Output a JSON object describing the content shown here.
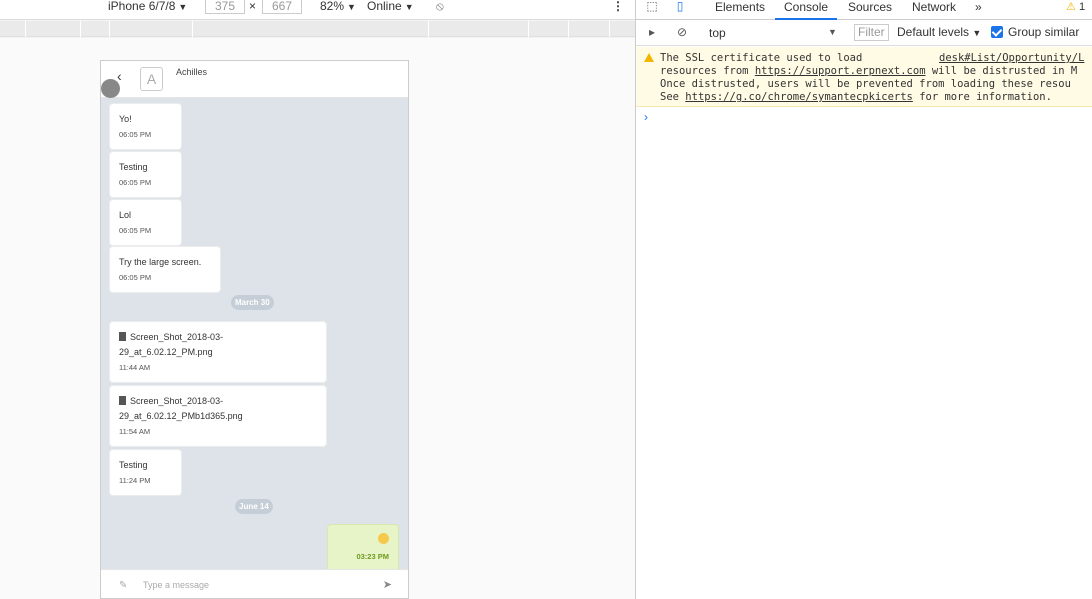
{
  "devtoolbar": {
    "device": "iPhone 6/7/8",
    "width": "375",
    "times": "×",
    "height": "667",
    "zoom": "82%",
    "network": "Online"
  },
  "chat": {
    "name": "Achilles",
    "avatar_letter": "A",
    "messages": [
      {
        "text": "Yo!",
        "time": "06:05 PM"
      },
      {
        "text": "Testing",
        "time": "06:05 PM"
      },
      {
        "text": "Lol",
        "time": "06:05 PM"
      },
      {
        "text": "Try the large screen.",
        "time": "06:05 PM"
      },
      {
        "file_line1": "Screen_Shot_2018-03-",
        "file_line2": "29_at_6.02.12_PM.png",
        "time": "11:44 AM"
      },
      {
        "file_line1": "Screen_Shot_2018-03-",
        "file_line2": "29_at_6.02.12_PMb1d365.png",
        "time": "11:54 AM"
      },
      {
        "text": "Testing",
        "time": "11:24 PM"
      },
      {
        "time": "03:23 PM"
      }
    ],
    "dates": [
      "March 30",
      "June 14"
    ],
    "composer_placeholder": "Type a message"
  },
  "devtools": {
    "tabs": [
      "Elements",
      "Console",
      "Sources",
      "Network"
    ],
    "more": "»",
    "warning_count": "1",
    "context": "top",
    "filter": "Filter",
    "levels": "Default levels",
    "group_similar": "Group similar",
    "warning": {
      "l1a": "The SSL certificate used to load",
      "l1b": "desk#List/Opportunity/L",
      "l2a": "resources from ",
      "l2link": "https://support.erpnext.com",
      "l2b": " will be distrusted in M",
      "l3": "Once distrusted, users will be prevented from loading these resou",
      "l4a": "See ",
      "l4link": "https://g.co/chrome/symantecpkicerts",
      "l4b": " for more information."
    },
    "prompt": "›"
  },
  "colors": {
    "accent": "#1a73e8",
    "warning_bg": "#fffbe5",
    "mine_bubble": "#e6f4c8"
  }
}
